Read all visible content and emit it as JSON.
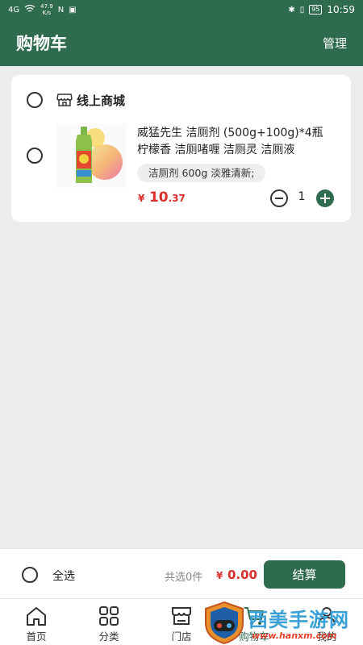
{
  "status_bar": {
    "carrier": "4G",
    "net_speed_value": "47.9",
    "net_speed_unit": "K/s",
    "nfc": "N",
    "battery": "95",
    "time": "10:59"
  },
  "header": {
    "title": "购物车",
    "manage_label": "管理"
  },
  "shop": {
    "name": "线上商城",
    "item": {
      "name": "威猛先生 洁厕剂 (500g+100g)*4瓶 柠檬香 洁厕啫喱 洁厕灵 洁厕液",
      "spec": "洁厕剂 600g 淡雅清新;",
      "price_symbol": "¥",
      "price_integer": "10",
      "price_decimal": ".37",
      "quantity": "1"
    }
  },
  "checkout": {
    "select_all_label": "全选",
    "selected_count_text": "共选0件",
    "total_symbol": "¥",
    "total_amount": "0.00",
    "checkout_button_label": "结算"
  },
  "tabs": [
    {
      "label": "首页",
      "icon": "home-icon"
    },
    {
      "label": "分类",
      "icon": "category-icon"
    },
    {
      "label": "门店",
      "icon": "store-icon"
    },
    {
      "label": "购物车",
      "icon": "cart-icon"
    },
    {
      "label": "我的",
      "icon": "profile-icon"
    }
  ],
  "watermark": {
    "text": "西美手游网",
    "url": "www.hanxm.com"
  },
  "colors": {
    "primary": "#2f6b4f",
    "price_red": "#d9302b",
    "background": "#ececec"
  }
}
